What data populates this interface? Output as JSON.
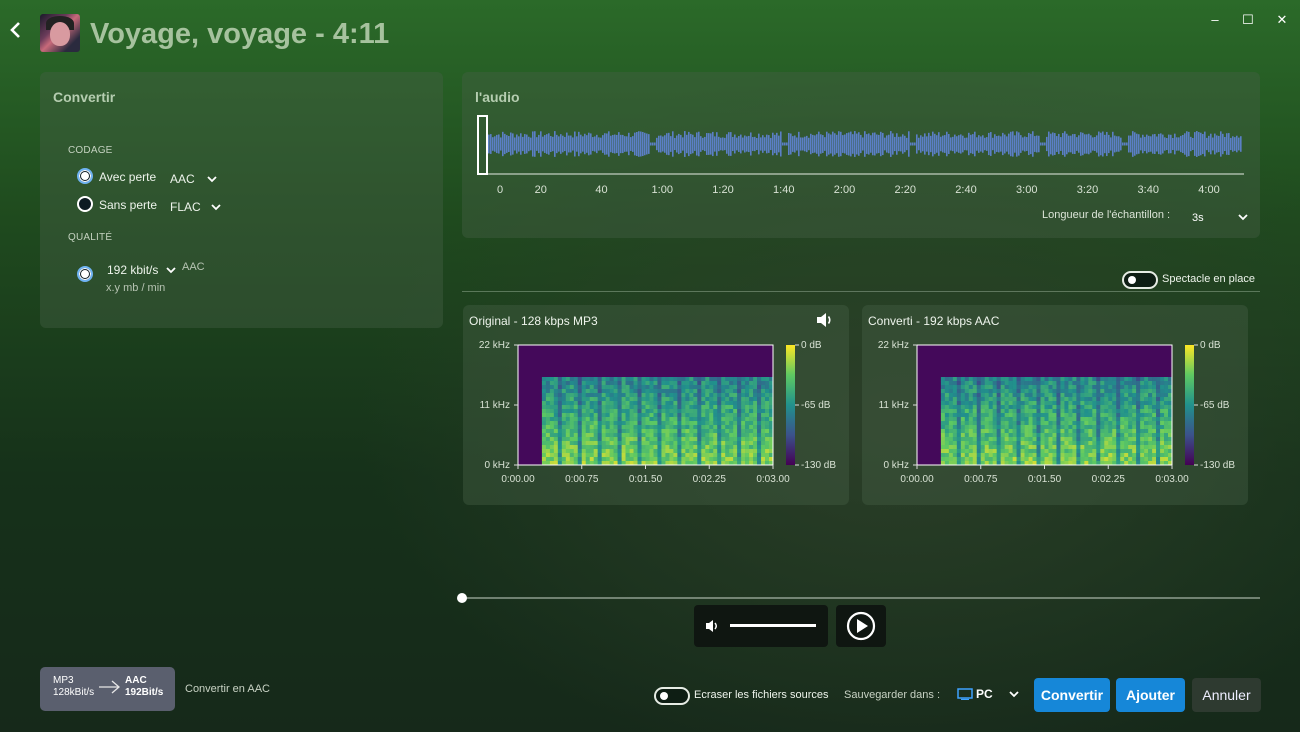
{
  "header": {
    "title": "Voyage, voyage - 4:11",
    "minimize": "–",
    "maximize": "☐",
    "close": "✕"
  },
  "convert": {
    "title": "Convertir",
    "codage_label": "CODAGE",
    "lossy_label": "Avec perte",
    "lossy_format": "AAC",
    "lossless_label": "Sans perte",
    "lossless_format": "FLAC",
    "quality_label": "QUALITÉ",
    "bitrate": "192 kbit/s",
    "bitrate_codec": "AAC",
    "size_estimate": "x.y mb / min"
  },
  "audio": {
    "title": "l'audio",
    "ticks": [
      "0",
      "20",
      "40",
      "1:00",
      "1:20",
      "1:40",
      "2:00",
      "2:20",
      "2:40",
      "3:00",
      "3:20",
      "3:40",
      "4:00"
    ],
    "sample_length_label": "Longueur de l'échantillon :",
    "sample_length_value": "3s",
    "waveform_color": "#5b7fc6"
  },
  "spectacle": {
    "label": "Spectacle en place"
  },
  "spectrograms": {
    "original": {
      "title": "Original - 128 kbps MP3"
    },
    "converted": {
      "title": "Converti - 192 kbps AAC"
    },
    "y_ticks": [
      "22 kHz",
      "11 kHz",
      "0 kHz"
    ],
    "x_ticks": [
      "0:00.00",
      "0:00.75",
      "0:01.50",
      "0:02.25",
      "0:03.00"
    ],
    "db_ticks": [
      "0 dB",
      "-65 dB",
      "-130 dB"
    ]
  },
  "player": {
    "progress": 0.0,
    "volume": 1.0
  },
  "footer": {
    "src_format": "MP3",
    "src_bitrate": "128kBit/s",
    "dst_format": "AAC",
    "dst_bitrate": "192Bit/s",
    "convert_desc": "Convertir en AAC",
    "overwrite_label": "Ecraser les fichiers sources",
    "save_in_label": "Sauvegarder dans :",
    "save_location": "PC",
    "convert_button": "Convertir",
    "add_button": "Ajouter",
    "cancel_button": "Annuler"
  }
}
